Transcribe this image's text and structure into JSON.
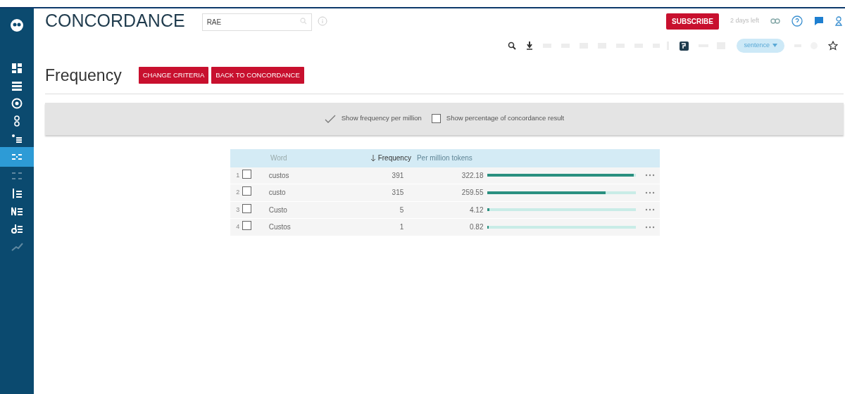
{
  "sidebar": {
    "items": [
      {
        "kind": "dashboard",
        "selected": false,
        "disabled": false
      },
      {
        "kind": "list",
        "selected": false,
        "disabled": false
      },
      {
        "kind": "target",
        "selected": false,
        "disabled": false
      },
      {
        "kind": "chain",
        "selected": false,
        "disabled": false
      },
      {
        "kind": "bullets",
        "selected": false,
        "disabled": false
      },
      {
        "kind": "columns",
        "selected": true,
        "disabled": false
      },
      {
        "kind": "grid",
        "selected": false,
        "disabled": true
      },
      {
        "kind": "sortlist",
        "selected": false,
        "disabled": false
      },
      {
        "kind": "nlist",
        "selected": false,
        "disabled": false
      },
      {
        "kind": "alist",
        "selected": false,
        "disabled": false
      },
      {
        "kind": "trend",
        "selected": false,
        "disabled": true
      }
    ]
  },
  "header": {
    "title": "CONCORDANCE",
    "search": {
      "value": "RAE"
    },
    "subscribe": "SUBSCRIBE",
    "trial": "2 days left"
  },
  "toolbar": {
    "dropdown": "sentence"
  },
  "page": {
    "title": "Frequency",
    "buttons": [
      "CHANGE CRITERIA",
      "BACK TO CONCORDANCE"
    ]
  },
  "options": [
    {
      "label": "Show frequency per million",
      "checked": true
    },
    {
      "label": "Show percentage of concordance result",
      "checked": false
    }
  ],
  "table": {
    "columns": [
      {
        "label": "Word",
        "sorted": false
      },
      {
        "label": "Frequency",
        "sorted": true
      },
      {
        "label": "Per million tokens",
        "sorted": false
      }
    ],
    "rows": [
      {
        "number": "1",
        "checked": false,
        "word": "custos",
        "frequency": "391",
        "per_million": "322.18",
        "level": 1.0
      },
      {
        "number": "2",
        "checked": false,
        "word": "custo",
        "frequency": "315",
        "per_million": "259.55",
        "level": 0.81
      },
      {
        "number": "3",
        "checked": false,
        "word": "Custo",
        "frequency": "5",
        "per_million": "4.12",
        "level": 0.013
      },
      {
        "number": "4",
        "checked": false,
        "word": "Custos",
        "frequency": "1",
        "per_million": "0.82",
        "level": 0.003
      }
    ]
  }
}
